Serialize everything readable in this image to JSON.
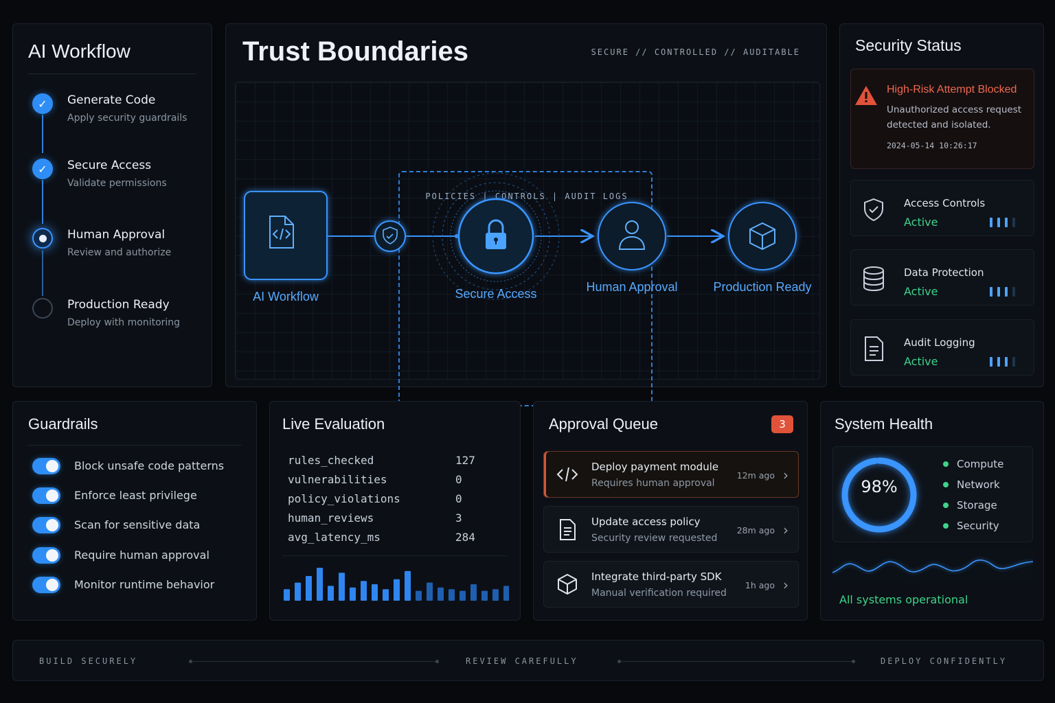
{
  "workflow": {
    "title": "AI Workflow",
    "steps": [
      {
        "title": "Generate Code",
        "subtitle": "Apply security guardrails",
        "state": "done"
      },
      {
        "title": "Secure Access",
        "subtitle": "Validate permissions",
        "state": "done"
      },
      {
        "title": "Human Approval",
        "subtitle": "Review and authorize",
        "state": "current"
      },
      {
        "title": "Production Ready",
        "subtitle": "Deploy with monitoring",
        "state": "pending"
      }
    ]
  },
  "trust": {
    "title": "Trust Boundaries",
    "tagline": "SECURE // CONTROLLED // AUDITABLE",
    "boundary_label": "POLICIES  |  CONTROLS  |  AUDIT LOGS",
    "nodes": [
      {
        "label": "AI Workflow",
        "icon": "code-file-icon"
      },
      {
        "label": "Secure Access",
        "icon": "lock-icon"
      },
      {
        "label": "Human Approval",
        "icon": "user-icon"
      },
      {
        "label": "Production Ready",
        "icon": "cube-icon"
      }
    ]
  },
  "security": {
    "title": "Security Status",
    "alert": {
      "title": "High-Risk Attempt Blocked",
      "message": "Unauthorized access request detected and isolated.",
      "timestamp": "2024-05-14 10:26:17"
    },
    "items": [
      {
        "name": "Access Controls",
        "status": "Active",
        "icon": "shield-check-icon",
        "level": 0.75
      },
      {
        "name": "Data Protection",
        "status": "Active",
        "icon": "database-icon",
        "level": 0.75
      },
      {
        "name": "Audit Logging",
        "status": "Active",
        "icon": "document-icon",
        "level": 0.75
      }
    ]
  },
  "guardrails": {
    "title": "Guardrails",
    "items": [
      {
        "label": "Block unsafe code patterns",
        "enabled": true
      },
      {
        "label": "Enforce least privilege",
        "enabled": true
      },
      {
        "label": "Scan for sensitive data",
        "enabled": true
      },
      {
        "label": "Require human approval",
        "enabled": true
      },
      {
        "label": "Monitor runtime behavior",
        "enabled": true
      }
    ]
  },
  "live": {
    "title": "Live Evaluation",
    "metrics": [
      {
        "key": "rules_checked",
        "value": "127"
      },
      {
        "key": "vulnerabilities",
        "value": "0"
      },
      {
        "key": "policy_violations",
        "value": "0"
      },
      {
        "key": "human_reviews",
        "value": "3"
      },
      {
        "key": "avg_latency_ms",
        "value": "284"
      }
    ],
    "activity": [
      0.35,
      0.55,
      0.75,
      1.0,
      0.45,
      0.85,
      0.4,
      0.6,
      0.5,
      0.35,
      0.65,
      0.9,
      0.3,
      0.55,
      0.4,
      0.35,
      0.3,
      0.5,
      0.3,
      0.35,
      0.45
    ]
  },
  "queue": {
    "title": "Approval Queue",
    "count": "3",
    "items": [
      {
        "title": "Deploy payment module",
        "subtitle": "Requires human approval",
        "time": "12m ago",
        "icon": "code-icon",
        "urgent": true
      },
      {
        "title": "Update access policy",
        "subtitle": "Security review requested",
        "time": "28m ago",
        "icon": "document-icon",
        "urgent": false
      },
      {
        "title": "Integrate third-party SDK",
        "subtitle": "Manual verification required",
        "time": "1h ago",
        "icon": "cube-icon",
        "urgent": false
      }
    ]
  },
  "health": {
    "title": "System Health",
    "percent": "98%",
    "percent_value": 0.98,
    "components": [
      "Compute",
      "Network",
      "Storage",
      "Security"
    ],
    "status": "All systems operational"
  },
  "footer": {
    "items": [
      "BUILD  SECURELY",
      "REVIEW  CAREFULLY",
      "DEPLOY  CONFIDENTLY"
    ]
  },
  "colors": {
    "accent": "#3a95ff",
    "success": "#3fd38a",
    "danger": "#f0684f",
    "background": "#07090d"
  }
}
